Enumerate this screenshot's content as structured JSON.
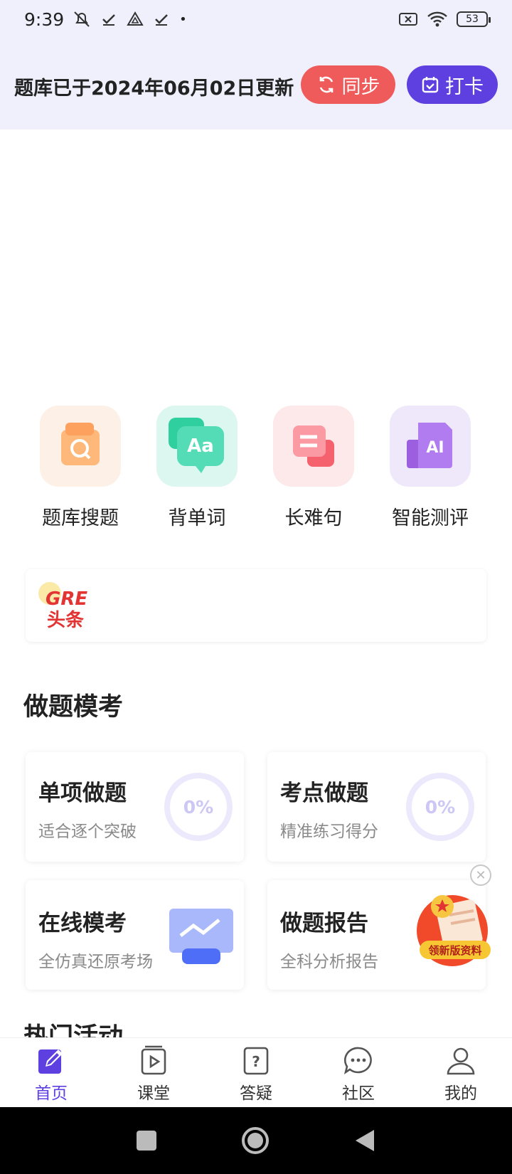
{
  "status_bar": {
    "time": "9:39",
    "battery": "53"
  },
  "header": {
    "update_text": "题库已于2024年06月02日更新",
    "sync_label": "同步",
    "checkin_label": "打卡",
    "sync_color": "#ef5a5a",
    "checkin_color": "#5e3fe0"
  },
  "quick_actions": [
    {
      "label": "题库搜题",
      "icon": "search-bank-icon"
    },
    {
      "label": "背单词",
      "icon": "vocabulary-icon"
    },
    {
      "label": "长难句",
      "icon": "long-sentence-icon"
    },
    {
      "label": "智能测评",
      "icon": "ai-assessment-icon"
    }
  ],
  "news": {
    "logo_line1": "GRE",
    "logo_line2": "头条"
  },
  "practice": {
    "section_title": "做题模考",
    "cards": [
      {
        "title": "单项做题",
        "subtitle": "适合逐个突破",
        "progress": "0%"
      },
      {
        "title": "考点做题",
        "subtitle": "精准练习得分",
        "progress": "0%"
      },
      {
        "title": "在线模考",
        "subtitle": "全仿真还原考场"
      },
      {
        "title": "做题报告",
        "subtitle": "全科分析报告"
      }
    ]
  },
  "promo": {
    "badge": "领新版资料"
  },
  "next_section_title": "热门活动",
  "bottom_nav": [
    {
      "label": "首页",
      "icon": "home-edit-icon",
      "active": true
    },
    {
      "label": "课堂",
      "icon": "classroom-icon",
      "active": false
    },
    {
      "label": "答疑",
      "icon": "question-icon",
      "active": false
    },
    {
      "label": "社区",
      "icon": "chat-bubble-icon",
      "active": false
    },
    {
      "label": "我的",
      "icon": "profile-icon",
      "active": false
    }
  ],
  "colors": {
    "accent": "#5e3fe0",
    "header_bg": "#f0f0fd"
  }
}
